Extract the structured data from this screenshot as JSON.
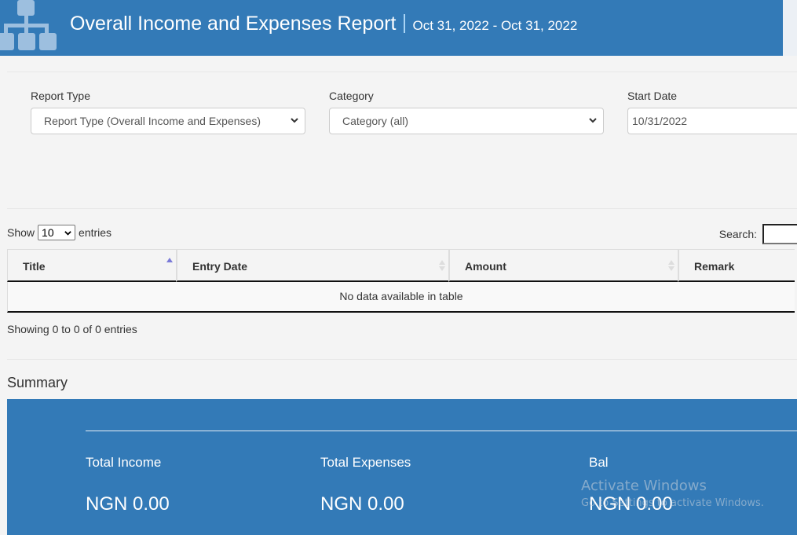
{
  "header": {
    "logo_icon": "sitemap-icon",
    "title": "Overall Income and Expenses Report",
    "separator": "|",
    "date_range": "Oct 31, 2022 - Oct 31, 2022"
  },
  "filters": {
    "report_type": {
      "label": "Report Type",
      "value": "Report Type (Overall Income and Expenses)"
    },
    "category": {
      "label": "Category",
      "value": "Category (all)"
    },
    "start_date": {
      "label": "Start Date",
      "value": "10/31/2022"
    }
  },
  "table_controls": {
    "show_label": "Show",
    "page_length": "10",
    "entries_label": "entries",
    "search_label": "Search:",
    "search_value": ""
  },
  "table": {
    "columns": [
      {
        "label": "Title",
        "sort": "ascending"
      },
      {
        "label": "Entry Date",
        "sort": "both"
      },
      {
        "label": "Amount",
        "sort": "both"
      },
      {
        "label": "Remark",
        "sort": "none"
      }
    ],
    "empty_message": "No data available in table",
    "info": "Showing 0 to 0 of 0 entries"
  },
  "summary": {
    "title": "Summary",
    "items": [
      {
        "label": "Total Income",
        "value": "NGN 0.00"
      },
      {
        "label": "Total Expenses",
        "value": "NGN 0.00"
      },
      {
        "label": "Bal",
        "value": "NGN 0.00"
      }
    ]
  },
  "watermark": {
    "line1": "Activate Windows",
    "line2": "Go to Settings to activate Windows."
  },
  "colors": {
    "brand": "#337ab7",
    "sort_active": "#7b7bd8",
    "background": "#f4f4f4"
  }
}
